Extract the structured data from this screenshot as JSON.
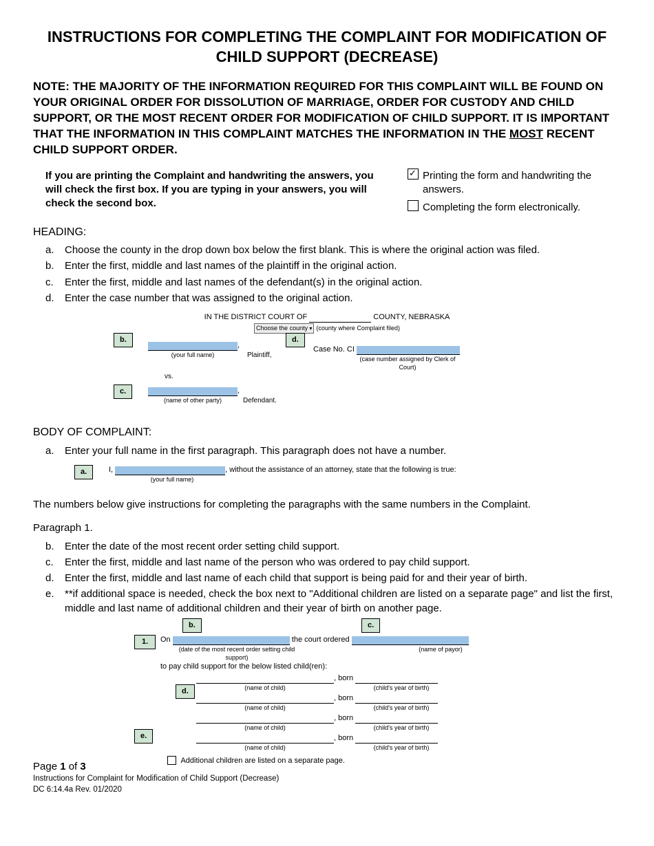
{
  "title": "INSTRUCTIONS FOR COMPLETING THE COMPLAINT FOR MODIFICATION OF CHILD SUPPORT (DECREASE)",
  "note_prefix": "NOTE: THE MAJORITY OF THE INFORMATION REQUIRED FOR THIS COMPLAINT WILL BE FOUND ON YOUR ORIGINAL ORDER FOR DISSOLUTION OF MARRIAGE, ORDER FOR CUSTODY AND CHILD SUPPORT, OR THE MOST RECENT ORDER FOR MODIFICATION OF CHILD SUPPORT. IT IS IMPORTANT THAT THE INFORMATION IN THIS COMPLAINT MATCHES THE INFORMATION IN THE ",
  "note_underline": "MOST",
  "note_suffix": " RECENT CHILD SUPPORT ORDER.",
  "printing_instruction": "If you are printing the Complaint and handwriting the answers, you will check the first box. If you are typing in your answers, you will check the second box.",
  "checkbox1_label": "Printing the form and handwriting the answers.",
  "checkbox2_label": "Completing the form electronically.",
  "heading_label": "HEADING:",
  "heading_items": {
    "a": "Choose the county in the drop down box below the first blank. This is where the original action was filed.",
    "b": "Enter the first, middle and last names of the plaintiff in the original action.",
    "c": "Enter the first, middle and last names of the defendant(s) in the original action.",
    "d": "Enter the case number that was assigned to the original action."
  },
  "court_header_prefix": "IN THE DISTRICT COURT OF ",
  "court_header_suffix": " COUNTY, NEBRASKA",
  "dropdown_label": "Choose the county",
  "county_caption": "(county where Complaint filed)",
  "your_full_name_caption": "(your full name)",
  "plaintiff_label": "Plaintiff,",
  "vs_label": "vs.",
  "other_party_caption": "(name of other party)",
  "defendant_label": "Defendant.",
  "case_no_label": "Case No. CI",
  "case_no_caption": "(case number assigned by Clerk of Court)",
  "body_label": "BODY OF COMPLAINT:",
  "body_a": "Enter your full name in the first paragraph. This paragraph does not have a number.",
  "intro_i": "I, ",
  "intro_mid": ", without the assistance of an attorney, state that the following is true:",
  "numbers_below": "The numbers below give instructions for completing the paragraphs with the same numbers in the Complaint.",
  "para1_label": "Paragraph 1.",
  "para1_items": {
    "b": "Enter the date of the most recent order setting child support.",
    "c": "Enter the first, middle and last name of the person who was ordered to pay child support.",
    "d": "Enter the first, middle and last name of each child that support is being paid for and their year of birth.",
    "e": "**if additional space is needed, check the box next to \"Additional children are listed on a separate page\" and list the first, middle and last name of additional children and their year of birth on another page."
  },
  "p1_on": "On ",
  "p1_date_caption": "(date of the most recent order setting child support)",
  "p1_court_ordered": " the court ordered ",
  "p1_payor_caption": "(name of payor)",
  "p1_pay_line": "to pay child support for the below listed child(ren):",
  "p1_born": ", born ",
  "p1_name_child": "(name of child)",
  "p1_year_birth": "(child's year of birth)",
  "p1_additional": "Additional children are listed on a separate page.",
  "callouts": {
    "a": "a.",
    "b": "b.",
    "c": "c.",
    "d": "d.",
    "e": "e.",
    "one": "1."
  },
  "footer": {
    "page_prefix": "Page ",
    "page_num": "1",
    "page_of": " of ",
    "page_total": "3",
    "line2": "Instructions for Complaint for Modification of Child Support (Decrease)",
    "line3": "DC 6:14.4a Rev. 01/2020"
  }
}
